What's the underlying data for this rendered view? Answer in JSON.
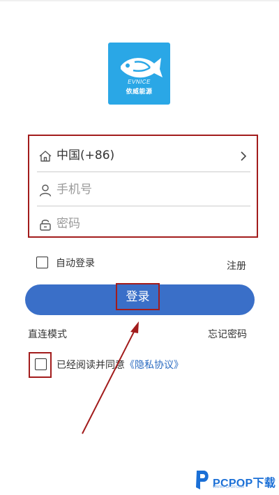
{
  "logo": {
    "brand": "EVNICE",
    "brand_cn": "依威能源",
    "color": "#2aa7e6"
  },
  "form": {
    "country": {
      "value": "中国(+86)",
      "icon": "home-icon",
      "trailing_icon": "chevron-right-icon"
    },
    "phone": {
      "placeholder": "手机号",
      "value": "",
      "icon": "user-icon"
    },
    "password": {
      "placeholder": "密码",
      "value": "",
      "icon": "lock-icon"
    }
  },
  "auto_login": {
    "label": "自动登录",
    "checked": false
  },
  "register_label": "注册",
  "login_button": {
    "label": "登录",
    "color": "#3a6fc8"
  },
  "direct_mode_label": "直连模式",
  "forgot_password_label": "忘记密码",
  "agreement": {
    "checked": false,
    "text": "已经阅读并同意",
    "link": "《隐私协议》",
    "link_color": "#2a6bc1"
  },
  "highlight_color": "#a21c1c",
  "watermark": {
    "text": "PCPOP下载",
    "sub": "WWW.PCPOP.COM"
  }
}
